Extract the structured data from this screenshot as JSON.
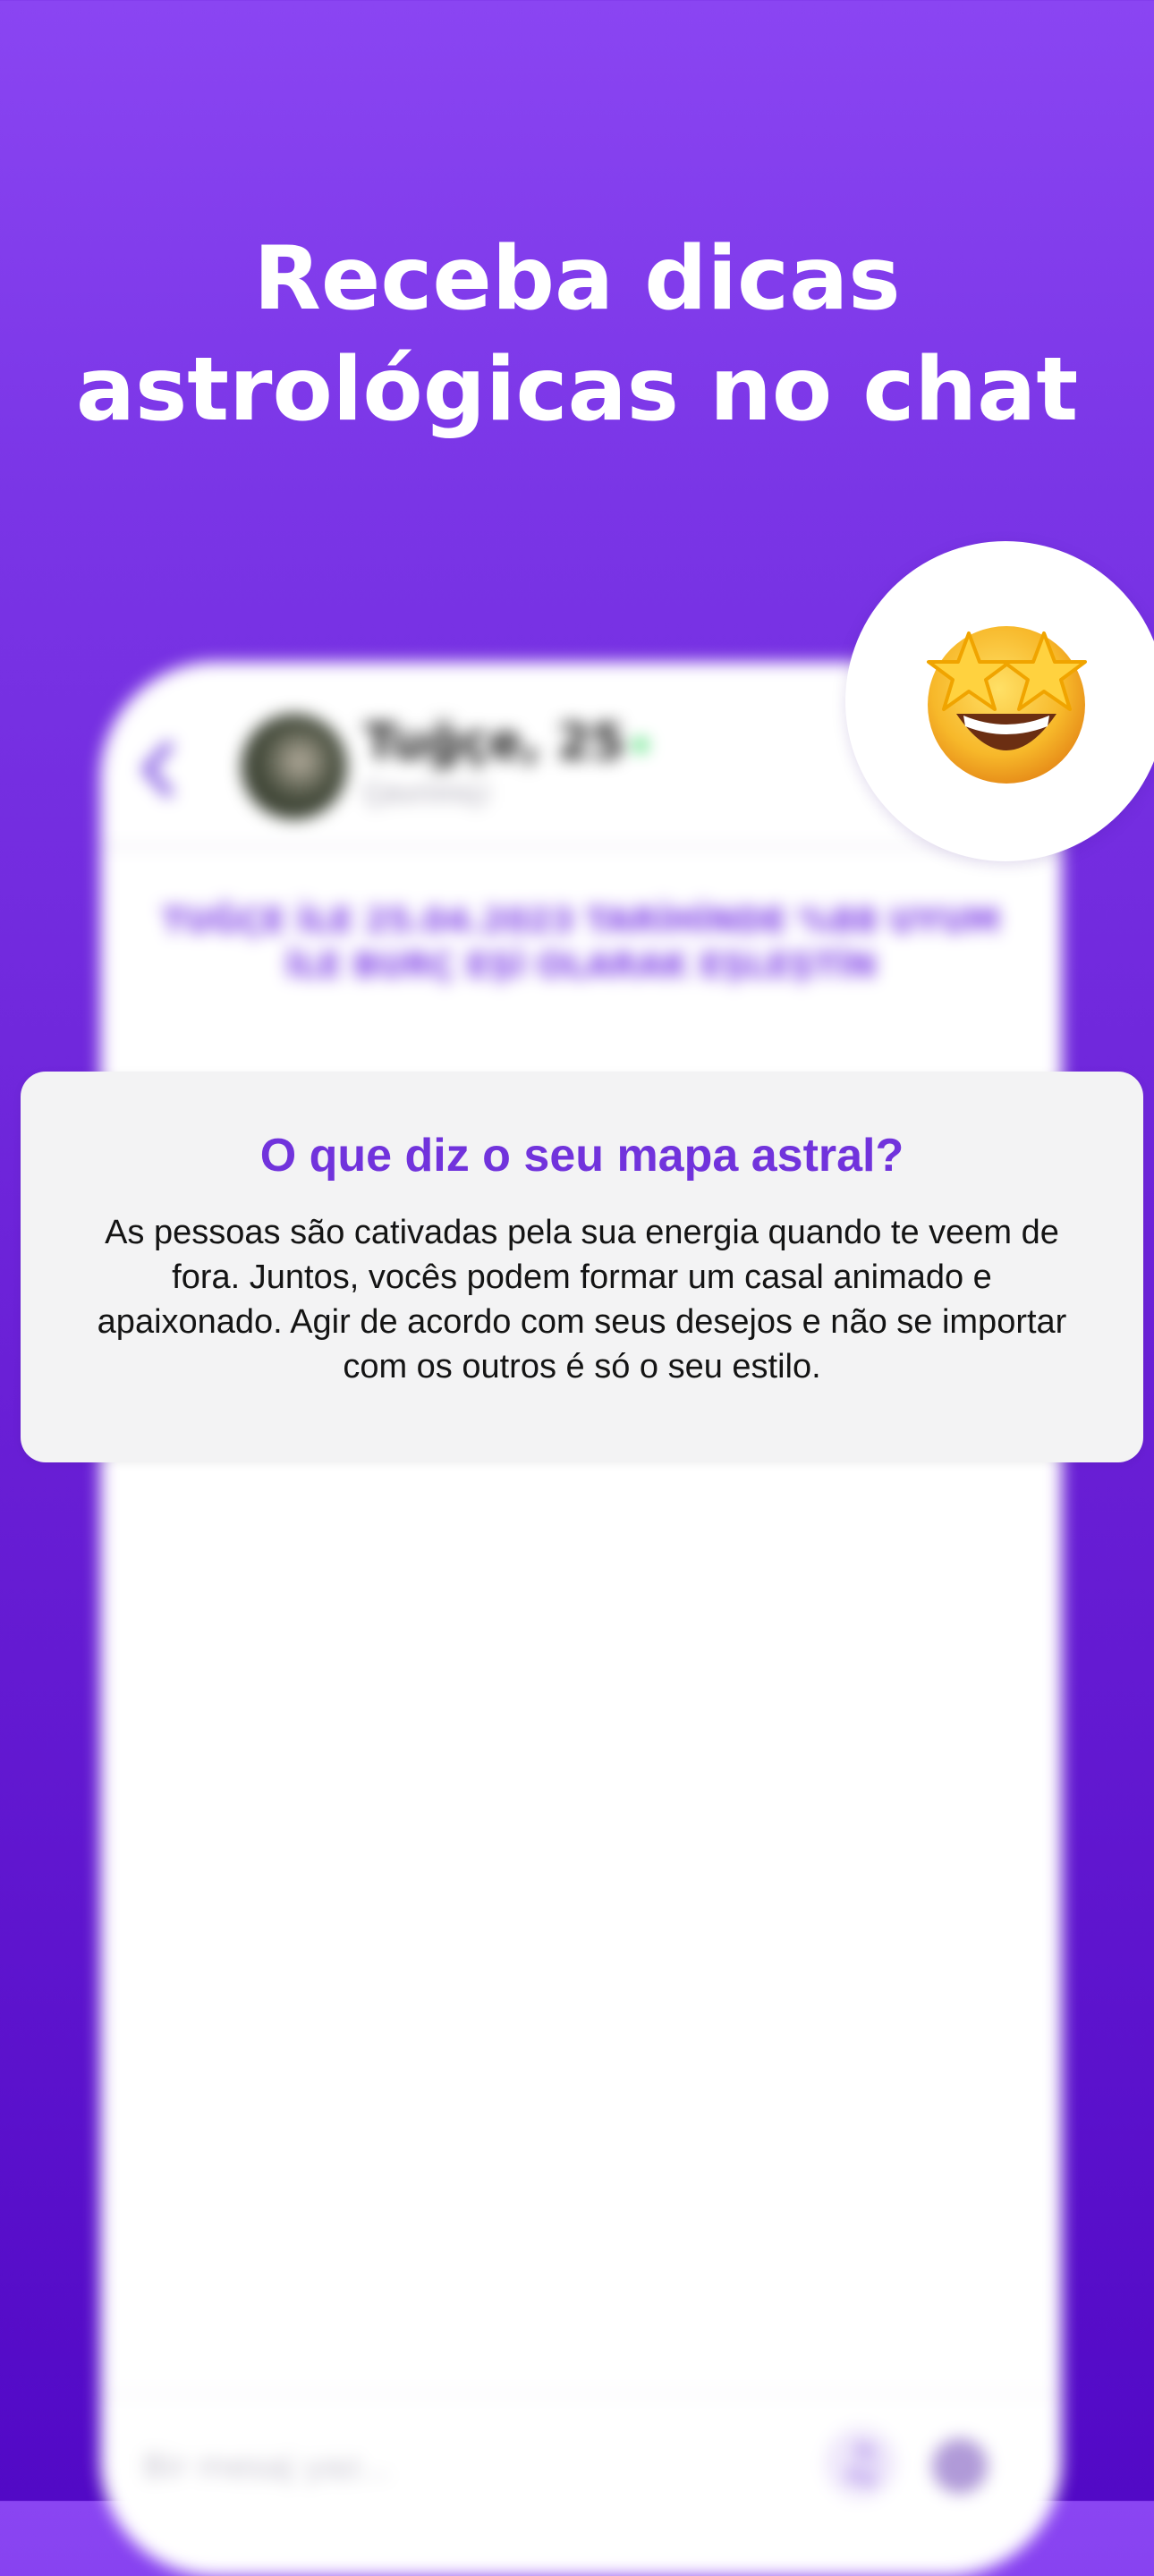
{
  "headline": {
    "line1": "Receba dicas",
    "line2": "astrológicas no chat"
  },
  "chat": {
    "name": "Tuğçe, 25",
    "status": "Çevrimiçi",
    "notice": "TUĞÇE İLE 25.04.2023 TARİHİNDE %88 UYUM İLE BURÇ EŞİ OLARAK EŞLEŞTİN",
    "input_placeholder": "Bir mesaj yaz...",
    "music_icon": "♫"
  },
  "emoji": {
    "name": "star-struck-emoji"
  },
  "card": {
    "title": "O que diz o seu mapa astral?",
    "body": "As pessoas são cativadas pela sua energia quando te veem de fora. Juntos, vocês podem formar um casal animado e apaixonado. Agir de acordo com seus desejos e não se importar com os outros é só o seu estilo."
  },
  "colors": {
    "background_top": "#8a45f2",
    "background_bottom": "#5209c6",
    "accent": "#7133dc",
    "card_background": "#f3f3f4"
  }
}
